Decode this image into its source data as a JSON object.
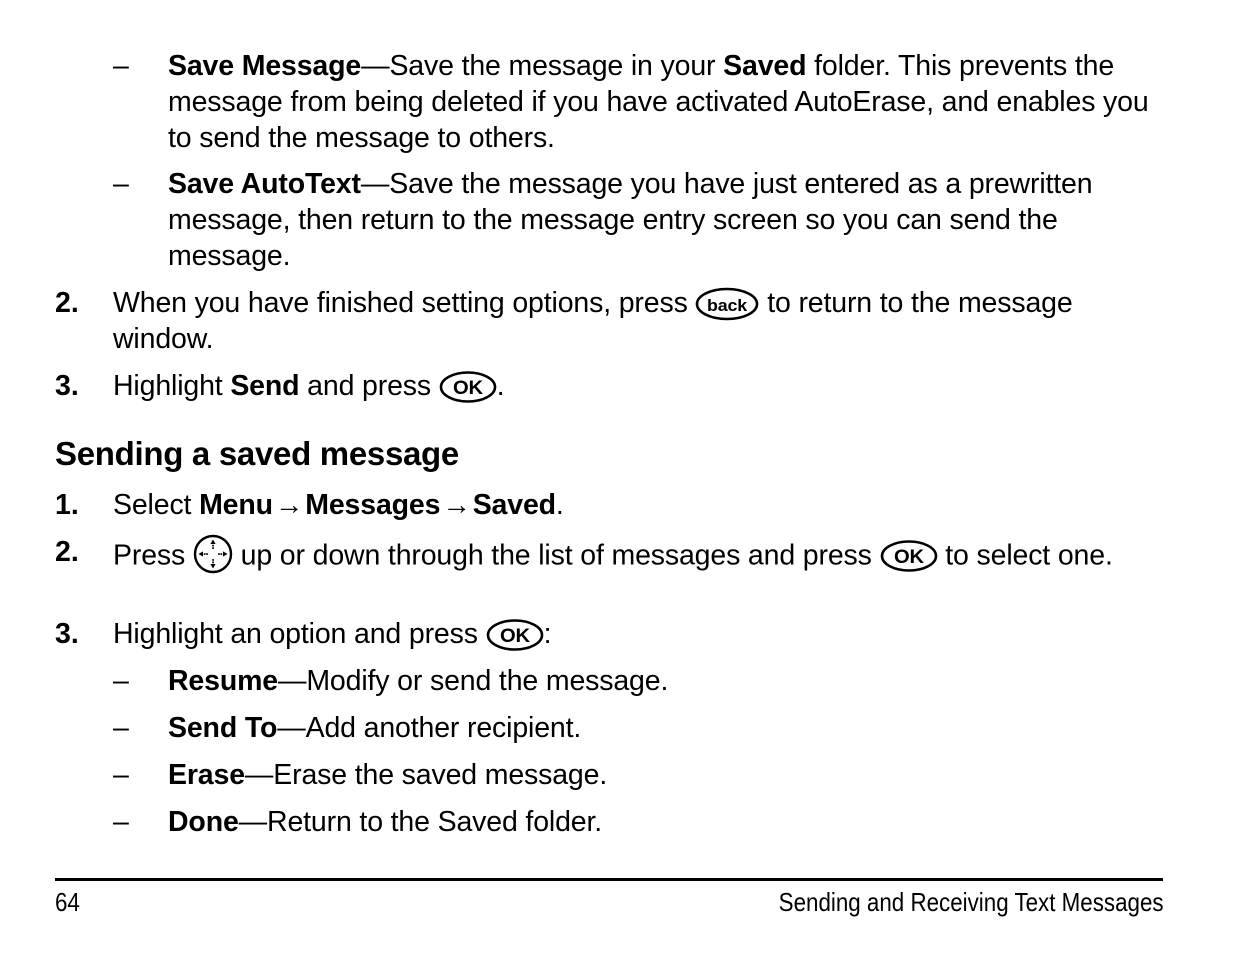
{
  "page": {
    "number": "64",
    "footer_title": "Sending and Receiving Text Messages"
  },
  "icons": {
    "back_key_label": "back",
    "ok_key_label": "OK",
    "nav_key_name": "navigation-key"
  },
  "blocks": {
    "bullet_save_message": {
      "marker": "–",
      "term": "Save Message",
      "dash": "—",
      "text": "Save the message in your ",
      "term2": "Saved",
      "text2": " folder. This prevents the message from being deleted if you have activated AutoErase, and enables you to send the message to others."
    },
    "bullet_save_autotext": {
      "marker": "–",
      "term": "Save AutoText",
      "dash": "—",
      "text": "Save the message you have just entered as a prewritten message, then return to the message entry screen so you can send the message."
    },
    "step_2_options": {
      "marker": "2.",
      "text_before": "When you have finished setting options, press ",
      "text_after": " to return to the message window."
    },
    "step_3_send": {
      "marker": "3.",
      "text_before": "Highlight ",
      "term": "Send",
      "text_mid": " and press ",
      "text_after": "."
    },
    "heading_sending_saved": "Sending a saved message",
    "step_1_select": {
      "marker": "1.",
      "text_before": "Select ",
      "term1": "Menu",
      "arrow1": "→",
      "term2": "Messages",
      "arrow2": "→",
      "term3": "Saved",
      "text_after": "."
    },
    "step_2_press": {
      "marker": "2.",
      "text_before": "Press ",
      "text_mid": " up or down through the list of messages and press ",
      "text_after": " to select one."
    },
    "step_3_highlight": {
      "marker": "3.",
      "text_before": "Highlight an option and press ",
      "text_after": ":"
    },
    "bullet_resume": {
      "marker": "–",
      "term": "Resume",
      "dash": "—",
      "text": "Modify or send the message."
    },
    "bullet_send_to": {
      "marker": "–",
      "term": "Send To",
      "dash": "—",
      "text": "Add another recipient."
    },
    "bullet_erase": {
      "marker": "–",
      "term": "Erase",
      "dash": "—",
      "text": "Erase the saved message."
    },
    "bullet_done": {
      "marker": "–",
      "term": "Done",
      "dash": "—",
      "text": "Return to the Saved folder."
    }
  },
  "colors": {
    "text": "#000000",
    "background": "#ffffff"
  }
}
